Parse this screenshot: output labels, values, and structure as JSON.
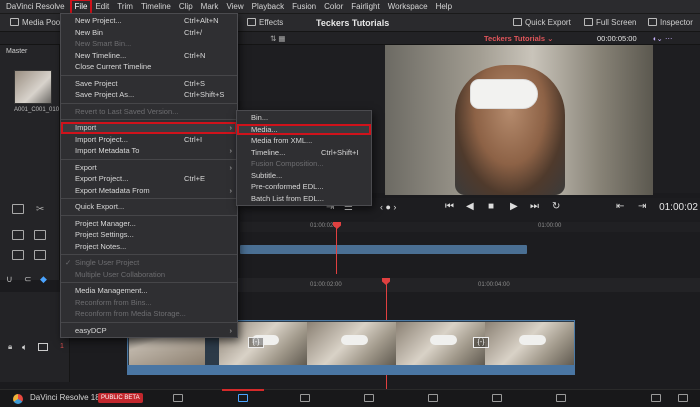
{
  "menubar": {
    "app_name": "DaVinci Resolve",
    "items": [
      "File",
      "Edit",
      "Trim",
      "Timeline",
      "Clip",
      "Mark",
      "View",
      "Playback",
      "Fusion",
      "Color",
      "Fairlight",
      "Workspace",
      "Help"
    ]
  },
  "toolbar": {
    "media_pool": "Media Poo",
    "effects": "Effects",
    "project_title": "Teckers Tutorials",
    "quick_export": "Quick Export",
    "full_screen": "Full Screen",
    "inspector": "Inspector"
  },
  "viewer_header": {
    "timeline_name": "Teckers Tutorials",
    "timecode": "00:00:05:00"
  },
  "media_pool": {
    "bin": "Master",
    "clip_name": "A001_C001_010"
  },
  "transport": {
    "timecode": "01:00:02"
  },
  "ruler": {
    "top_label_1": "01:00:02:",
    "top_label_2": "01:00:00",
    "bottom_label_1": "01:00:02:00",
    "bottom_label_2": "01:00:04:00"
  },
  "track": {
    "number": "1",
    "fx_label": "{-}"
  },
  "bottom": {
    "brand": "DaVinci Resolve 18",
    "beta": "PUBLIC BETA"
  },
  "file_menu": {
    "new_project": "New Project...",
    "new_project_sc": "Ctrl+Alt+N",
    "new_bin": "New Bin",
    "new_bin_sc": "Ctrl+/",
    "new_smart_bin": "New Smart Bin...",
    "new_timeline": "New Timeline...",
    "new_timeline_sc": "Ctrl+N",
    "close_timeline": "Close Current Timeline",
    "save_project": "Save Project",
    "save_project_sc": "Ctrl+S",
    "save_project_as": "Save Project As...",
    "save_project_as_sc": "Ctrl+Shift+S",
    "revert": "Revert to Last Saved Version...",
    "import": "Import",
    "import_project": "Import Project...",
    "import_project_sc": "Ctrl+I",
    "import_metadata": "Import Metadata To",
    "export": "Export",
    "export_project": "Export Project...",
    "export_project_sc": "Ctrl+E",
    "export_metadata": "Export Metadata From",
    "quick_export": "Quick Export...",
    "project_manager": "Project Manager...",
    "project_settings": "Project Settings...",
    "project_notes": "Project Notes...",
    "single_user": "Single User Project",
    "multi_user": "Multiple User Collaboration",
    "media_management": "Media Management...",
    "reconform_bins": "Reconform from Bins...",
    "reconform_storage": "Reconform from Media Storage...",
    "easydcp": "easyDCP"
  },
  "import_menu": {
    "bin": "Bin...",
    "media": "Media...",
    "media_from_xml": "Media from XML...",
    "timeline": "Timeline...",
    "timeline_sc": "Ctrl+Shift+I",
    "fusion_composition": "Fusion Composition...",
    "subtitle": "Subtitle...",
    "preconformed_edl": "Pre-conformed EDL...",
    "batch_list": "Batch List from EDL..."
  }
}
